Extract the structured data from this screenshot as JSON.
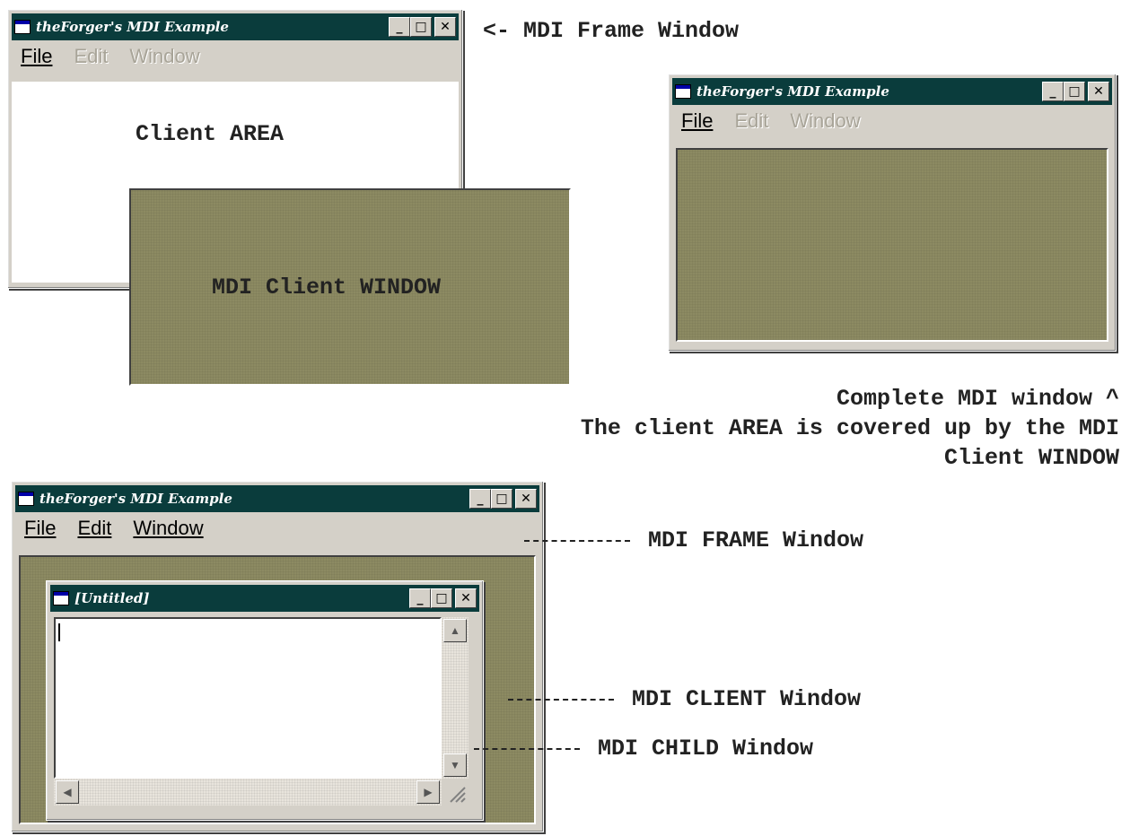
{
  "window_title": "theForger's MDI Example",
  "child_title": "[Untitled]",
  "menu": {
    "file": "File",
    "edit": "Edit",
    "window": "Window"
  },
  "controls": {
    "minimize": "_",
    "maximize": "□",
    "close": "✕"
  },
  "labels": {
    "client_area": "Client AREA",
    "mdi_client_window": "MDI Client WINDOW",
    "frame_arrow": "<- MDI Frame Window",
    "complete_1": "Complete MDI window ^",
    "complete_2": "The client AREA is covered up by the MDI",
    "complete_3": "Client WINDOW",
    "frame_label": "MDI FRAME Window",
    "client_label": "MDI CLIENT Window",
    "child_label": "MDI CHILD Window"
  },
  "colors": {
    "titlebar": "#0a3c3c",
    "mdi_client": "#8c8a62",
    "face": "#d4d0c8"
  },
  "icons": [
    "app-icon",
    "minimize-icon",
    "maximize-icon",
    "close-icon",
    "scroll-up-icon",
    "scroll-down-icon",
    "scroll-left-icon",
    "scroll-right-icon",
    "size-grip-icon"
  ]
}
